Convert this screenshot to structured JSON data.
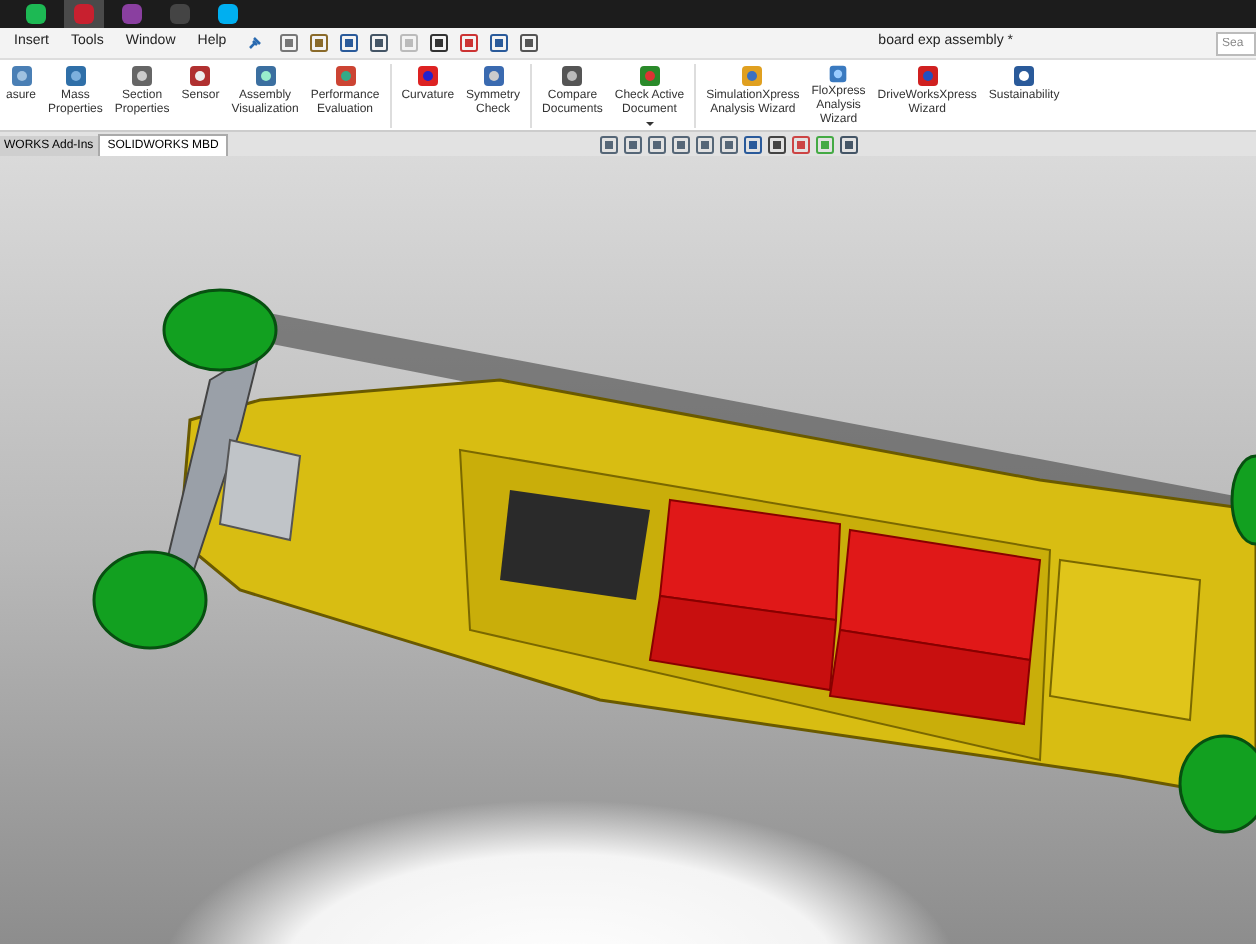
{
  "taskbar": {
    "apps": [
      {
        "kind": "spotify",
        "selected": false
      },
      {
        "kind": "solidworks",
        "selected": true
      },
      {
        "kind": "bars",
        "selected": false
      },
      {
        "kind": "gc",
        "selected": false
      },
      {
        "kind": "skype",
        "selected": false
      }
    ]
  },
  "menu": {
    "items": [
      "Insert",
      "Tools",
      "Window",
      "Help"
    ]
  },
  "window": {
    "title": "board exp assembly *"
  },
  "search": {
    "placeholder": "Sea"
  },
  "ribbon": {
    "items": [
      {
        "label": "asure",
        "kind": "measure",
        "dropdown": false,
        "separator_after": false
      },
      {
        "label": "Mass\nProperties",
        "kind": "mass",
        "dropdown": false,
        "separator_after": false
      },
      {
        "label": "Section\nProperties",
        "kind": "section",
        "dropdown": false,
        "separator_after": false
      },
      {
        "label": "Sensor",
        "kind": "sensor",
        "dropdown": false,
        "separator_after": false
      },
      {
        "label": "Assembly\nVisualization",
        "kind": "assembly",
        "dropdown": false,
        "separator_after": false
      },
      {
        "label": "Performance\nEvaluation",
        "kind": "performance",
        "dropdown": false,
        "separator_after": true
      },
      {
        "label": "Curvature",
        "kind": "curvature",
        "dropdown": false,
        "separator_after": false
      },
      {
        "label": "Symmetry\nCheck",
        "kind": "symmetry",
        "dropdown": false,
        "separator_after": true
      },
      {
        "label": "Compare\nDocuments",
        "kind": "compare",
        "dropdown": false,
        "separator_after": false
      },
      {
        "label": "Check Active\nDocument",
        "kind": "check",
        "dropdown": true,
        "separator_after": true
      },
      {
        "label": "SimulationXpress\nAnalysis Wizard",
        "kind": "simulation",
        "dropdown": false,
        "separator_after": false
      },
      {
        "label": "FloXpress\nAnalysis\nWizard",
        "kind": "flow",
        "dropdown": false,
        "separator_after": false
      },
      {
        "label": "DriveWorksXpress\nWizard",
        "kind": "driveworks",
        "dropdown": false,
        "separator_after": false
      },
      {
        "label": "Sustainability",
        "kind": "sustainability",
        "dropdown": false,
        "separator_after": false
      }
    ]
  },
  "tabs": [
    {
      "label": "WORKS Add-Ins",
      "selected": false
    },
    {
      "label": "SOLIDWORKS MBD",
      "selected": true
    }
  ]
}
